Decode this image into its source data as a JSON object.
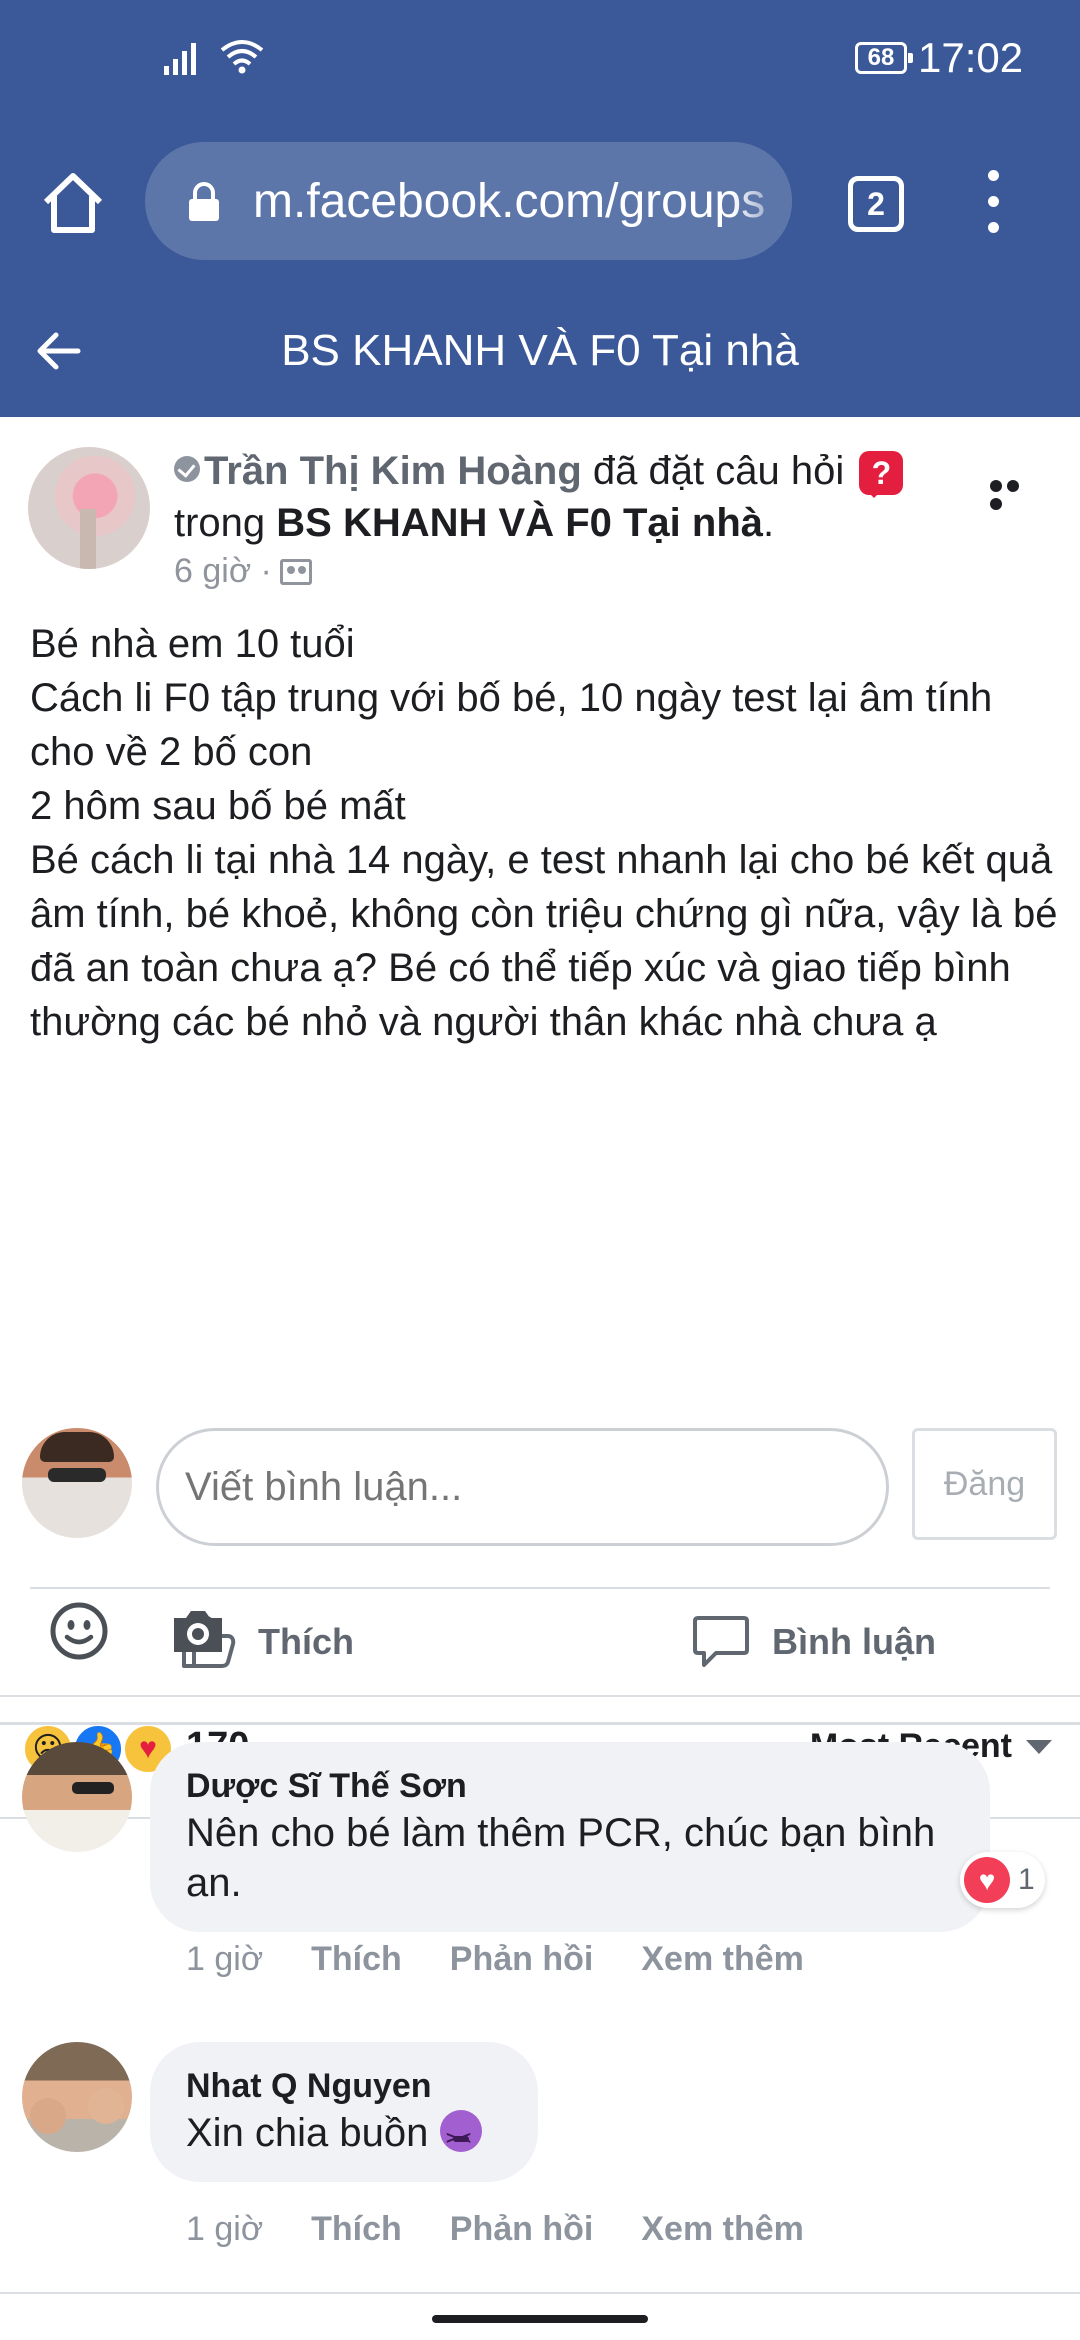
{
  "status_bar": {
    "battery": "68",
    "time": "17:02"
  },
  "browser": {
    "url": "m.facebook.com/groups",
    "tab_count": "2"
  },
  "group_header": {
    "title": "BS KHANH VÀ F0 Tại nhà"
  },
  "post": {
    "author": "Trần Thị Kim Hoàng",
    "action": "đã đặt câu hỏi",
    "question_badge": "?",
    "in_word": "trong",
    "group_name": "BS KHANH VÀ F0 Tại nhà",
    "group_period": ".",
    "time": "6 giờ ·",
    "body_lines": [
      "Bé nhà em 10 tuổi",
      "Cách li F0 tập trung với bố bé, 10 ngày test lại âm tính cho về 2 bố con",
      "2 hôm sau bố bé mất",
      "Bé cách li tại nhà 14 ngày, e test nhanh lại cho bé kết quả âm tính, bé khoẻ, không còn triệu chứng gì nữa, vậy là bé đã an toàn chưa ạ? Bé có thể tiếp xúc và giao tiếp bình thường các bé nhỏ và người thân khác nhà chưa ạ"
    ],
    "like_label": "Thích",
    "comment_label": "Bình luận",
    "reaction_count": "170",
    "sort_label": "Most Recent"
  },
  "composer": {
    "placeholder": "Viết bình luận...",
    "post_label": "Đăng"
  },
  "comments": [
    {
      "name": "Dược Sĩ Thế Sơn",
      "text": "Nên cho bé làm thêm PCR, chúc bạn bình an.",
      "reaction_count": "1",
      "time": "1 giờ",
      "like": "Thích",
      "reply": "Phản hồi",
      "more": "Xem thêm"
    },
    {
      "name": "Nhat Q Nguyen",
      "text": "Xin chia buồn",
      "time": "1 giờ",
      "like": "Thích",
      "reply": "Phản hồi",
      "more": "Xem thêm"
    }
  ],
  "colors": {
    "brand": "#3b5998",
    "love": "#f33e58",
    "like": "#1877f2"
  },
  "icons": [
    "signal-icon",
    "wifi-icon",
    "home-icon",
    "lock-icon",
    "tabs-icon",
    "overflow-menu-icon",
    "back-arrow-icon",
    "like-icon",
    "comment-icon",
    "emoji-icon",
    "camera-icon"
  ]
}
